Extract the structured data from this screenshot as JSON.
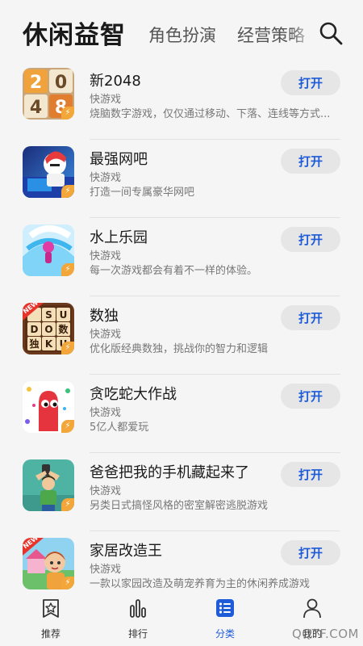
{
  "header": {
    "active_tab": "休闲益智",
    "tabs": [
      "角色扮演",
      "经营策略"
    ]
  },
  "open_label": "打开",
  "apps": [
    {
      "name": "新2048",
      "type": "快游戏",
      "desc": "烧脑数字游戏，仅仅通过移动、下落、连线等方式..."
    },
    {
      "name": "最强网吧",
      "type": "快游戏",
      "desc": "打造一间专属豪华网吧"
    },
    {
      "name": "水上乐园",
      "type": "快游戏",
      "desc": "每一次游戏都会有着不一样的体验。"
    },
    {
      "name": "数独",
      "type": "快游戏",
      "desc": "优化版经典数独，挑战你的智力和逻辑"
    },
    {
      "name": "贪吃蛇大作战",
      "type": "快游戏",
      "desc": "5亿人都爱玩"
    },
    {
      "name": "爸爸把我的手机藏起来了",
      "type": "快游戏",
      "desc": "另类日式搞怪风格的密室解密逃脱游戏"
    },
    {
      "name": "家居改造王",
      "type": "快游戏",
      "desc": "一款以家园改造及萌宠养育为主的休闲养成游戏"
    }
  ],
  "thumbs": {
    "t2048": {
      "digits": [
        "2",
        "0",
        "4",
        "8"
      ]
    },
    "sudoku": {
      "tag": "NEW",
      "letters": [
        "S",
        "U",
        "数",
        "D",
        "O",
        "独",
        "K",
        "U"
      ]
    },
    "home": {
      "tag": "NEW"
    }
  },
  "nav": [
    {
      "label": "推荐",
      "icon": "star-card-icon"
    },
    {
      "label": "排行",
      "icon": "bar-chart-icon"
    },
    {
      "label": "分类",
      "icon": "category-list-icon"
    },
    {
      "label": "我的",
      "icon": "person-icon"
    }
  ],
  "colors": {
    "accent": "#1d5bd8",
    "badge": "#f3a73a"
  },
  "watermark": "QQTF.COM"
}
